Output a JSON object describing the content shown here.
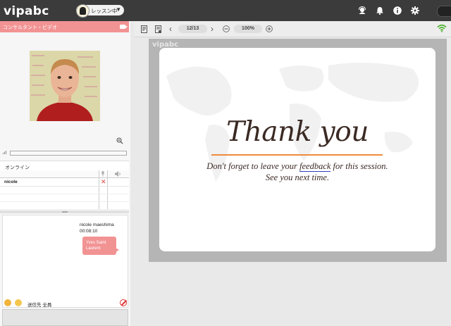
{
  "header": {
    "logo": "vipabc",
    "lesson_status": "レッスン中",
    "icons": [
      "headset-icon",
      "bell-icon",
      "info-icon",
      "gear-icon"
    ]
  },
  "left_panel": {
    "video_title": "コンサルタント・ビデオ",
    "online_title": "オンライン",
    "users": [
      {
        "name": "nicole",
        "status": "disconnected"
      }
    ],
    "chat": {
      "sender": "nicole maeshima",
      "time": "00:08:10",
      "bubble_text": "Yves Saint Laurent",
      "send_to_label": "送信先",
      "send_to_value": "全員"
    }
  },
  "slide_toolbar": {
    "page": "12/13",
    "zoom": "100%"
  },
  "slide": {
    "watermark": "vipabc",
    "title": "Thank you",
    "line1_before": "Don't forget to leave your ",
    "line1_link": "feedback",
    "line1_after": " for this session.",
    "line2": "See you next time."
  },
  "colors": {
    "topbar": "#3b3b3b",
    "accent_pink": "#f29393",
    "slide_underline": "#ef8c3c",
    "stage_gray": "#b5b5b5"
  }
}
